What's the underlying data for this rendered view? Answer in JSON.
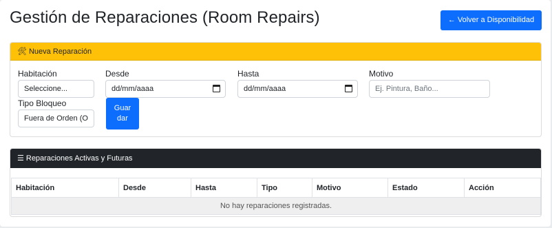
{
  "page": {
    "title": "Gestión de Reparaciones (Room Repairs)",
    "back_button": "Volver a Disponibilidad",
    "back_icon": "arrow-left-icon"
  },
  "new_repair": {
    "header": "Nueva Reparación",
    "header_icon": "tools-icon",
    "room_label": "Habitación",
    "room_value": "Seleccione...",
    "from_label": "Desde",
    "from_placeholder": "dd/mm/aaaa",
    "to_label": "Hasta",
    "to_placeholder": "dd/mm/aaaa",
    "reason_label": "Motivo",
    "reason_placeholder": "Ej. Pintura, Baño...",
    "block_type_label": "Tipo Bloqueo",
    "block_type_value": "Fuera de Orden (O",
    "save_line1": "Guar",
    "save_line2": "dar"
  },
  "repairs_list": {
    "header": "Reparaciones Activas y Futuras",
    "header_icon": "list-icon",
    "columns": [
      "Habitación",
      "Desde",
      "Hasta",
      "Tipo",
      "Motivo",
      "Estado",
      "Acción"
    ],
    "empty_message": "No hay reparaciones registradas."
  },
  "colors": {
    "primary": "#0d6efd",
    "warning": "#ffc107",
    "dark": "#212529"
  }
}
